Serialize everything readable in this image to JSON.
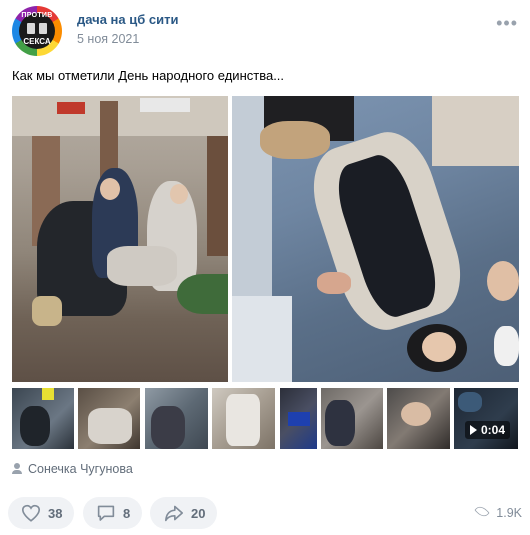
{
  "post": {
    "group_name": "дача на цб сити",
    "date": "5 ноя 2021",
    "text": "Как мы отметили День народного единства...",
    "avatar": {
      "top_text": "ПРОТИВ",
      "bottom_text": "СЕКСА"
    },
    "author": "Сонечка Чугунова"
  },
  "media": {
    "video_duration": "0:04"
  },
  "actions": {
    "likes": "38",
    "comments": "8",
    "shares": "20",
    "views": "1.9K"
  },
  "icons": {
    "more": "more-dots-icon",
    "author": "person-icon",
    "like": "heart-icon",
    "comment": "comment-icon",
    "share": "share-arrow-icon",
    "views": "eye-icon",
    "play": "play-icon"
  },
  "colors": {
    "link": "#2a5885",
    "secondary_text": "#818c99",
    "button_bg": "#f0f2f5",
    "icon": "#99a2ad"
  }
}
